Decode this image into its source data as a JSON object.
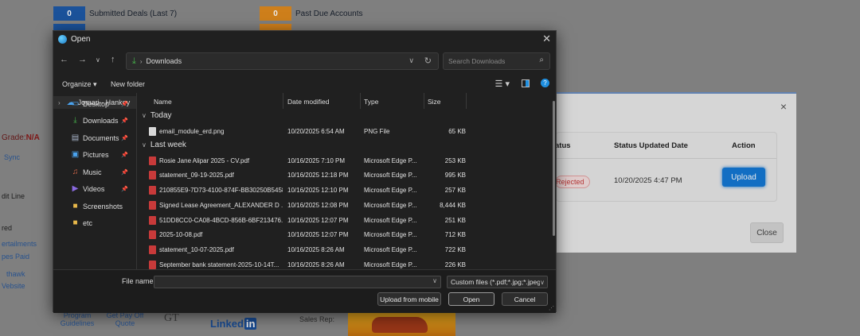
{
  "background": {
    "counters": [
      {
        "num": "0",
        "label": "Submitted Deals (Last 7)",
        "color": "#1e5aa8"
      },
      {
        "num": "0",
        "label": "Past Due Accounts",
        "color": "#e08a1e"
      }
    ],
    "grade_label": "Grade:",
    "grade_value": "N/A",
    "left_items": [
      "Sync",
      "dit Line",
      "red",
      "ertailments",
      "pes Paid",
      "thawk",
      "Vebsite"
    ],
    "footer": {
      "program_guidelines": "Program Guidelines",
      "get_pay_off_quote": "Get Pay Off Quote",
      "linkedin": "Linked",
      "linkedin_in": "in",
      "sales_rep": "Sales Rep:"
    }
  },
  "bg_modal": {
    "close_icon": "×",
    "columns": [
      "atus",
      "Status Updated Date",
      "Action"
    ],
    "status": "Rejected",
    "date": "10/20/2025 4:47 PM",
    "upload_label": "Upload",
    "close_label": "Close"
  },
  "dialog": {
    "title": "Open",
    "close": "✕",
    "location": "Downloads",
    "search_placeholder": "Search Downloads",
    "organize": "Organize ▾",
    "new_folder": "New folder",
    "sidebar_top": "Jomari - Hankey",
    "sidebar": [
      {
        "label": "Desktop",
        "icon": "desktop-icon",
        "glyph": "▭",
        "pinned": true
      },
      {
        "label": "Downloads",
        "icon": "downloads-icon",
        "glyph": "⤓",
        "pinned": true
      },
      {
        "label": "Documents",
        "icon": "documents-icon",
        "glyph": "▤",
        "pinned": true
      },
      {
        "label": "Pictures",
        "icon": "pictures-icon",
        "glyph": "▣",
        "pinned": true
      },
      {
        "label": "Music",
        "icon": "music-icon",
        "glyph": "♫",
        "pinned": true
      },
      {
        "label": "Videos",
        "icon": "videos-icon",
        "glyph": "▶",
        "pinned": true
      },
      {
        "label": "Screenshots",
        "icon": "folder-icon",
        "glyph": "■",
        "pinned": false
      },
      {
        "label": "etc",
        "icon": "folder-icon",
        "glyph": "■",
        "pinned": false
      }
    ],
    "columns": {
      "name": "Name",
      "date": "Date modified",
      "type": "Type",
      "size": "Size"
    },
    "groups": [
      {
        "label": "Today",
        "files": [
          {
            "name": "email_module_erd.png",
            "date": "10/20/2025 6:54 AM",
            "type": "PNG File",
            "size": "65 KB",
            "kind": "png"
          }
        ]
      },
      {
        "label": "Last week",
        "files": [
          {
            "name": "Rosie Jane Alipar 2025 - CV.pdf",
            "date": "10/16/2025 7:10 PM",
            "type": "Microsoft Edge P...",
            "size": "253 KB",
            "kind": "pdf"
          },
          {
            "name": "statement_09-19-2025.pdf",
            "date": "10/16/2025 12:18 PM",
            "type": "Microsoft Edge P...",
            "size": "995 KB",
            "kind": "pdf"
          },
          {
            "name": "210855E9-7D73-4100-874F-BB30250B5458...",
            "date": "10/16/2025 12:10 PM",
            "type": "Microsoft Edge P...",
            "size": "257 KB",
            "kind": "pdf"
          },
          {
            "name": "Signed Lease Agreement_ALEXANDER D ...",
            "date": "10/16/2025 12:08 PM",
            "type": "Microsoft Edge P...",
            "size": "8,444 KB",
            "kind": "pdf"
          },
          {
            "name": "51DD8CC0-CA08-4BCD-856B-6BF213476...",
            "date": "10/16/2025 12:07 PM",
            "type": "Microsoft Edge P...",
            "size": "251 KB",
            "kind": "pdf"
          },
          {
            "name": "2025-10-08.pdf",
            "date": "10/16/2025 12:07 PM",
            "type": "Microsoft Edge P...",
            "size": "712 KB",
            "kind": "pdf"
          },
          {
            "name": "statement_10-07-2025.pdf",
            "date": "10/16/2025 8:26 AM",
            "type": "Microsoft Edge P...",
            "size": "722 KB",
            "kind": "pdf"
          },
          {
            "name": "September bank statement-2025-10-14T...",
            "date": "10/16/2025 8:26 AM",
            "type": "Microsoft Edge P...",
            "size": "226 KB",
            "kind": "pdf"
          }
        ]
      }
    ],
    "file_name_label": "File name:",
    "file_name_value": "",
    "filter": "Custom files (*.pdf;*.jpg;*.jpeg;",
    "upload_mobile": "Upload from mobile",
    "open": "Open",
    "cancel": "Cancel"
  }
}
